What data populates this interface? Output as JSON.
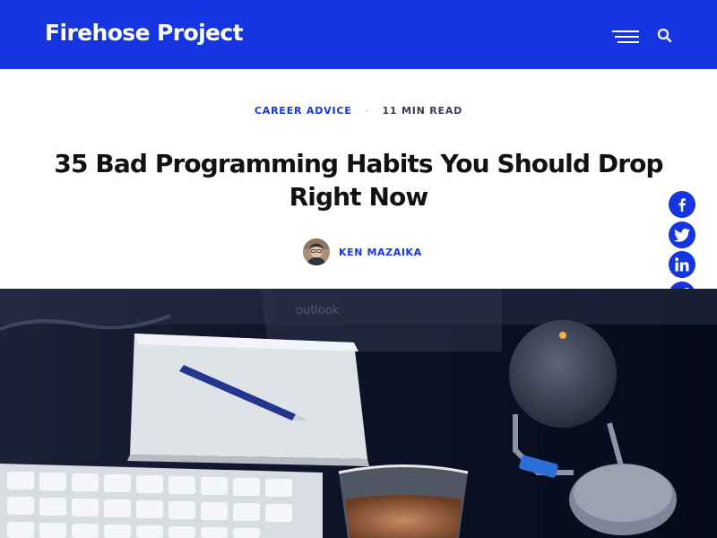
{
  "header": {
    "logo_text": "Firehose Project",
    "background_color": "#1535e0",
    "menu_icon": "hamburger-menu-icon",
    "search_icon": "search-icon"
  },
  "article": {
    "category": "CAREER ADVICE",
    "read_time": "11 MIN READ",
    "title_line1": "35 Bad Programming Habits You Should Drop",
    "title_line2": "Right Now",
    "author": {
      "name": "KEN MAZAIKA",
      "avatar_icon": "author-avatar"
    }
  },
  "share_buttons": [
    {
      "network": "facebook",
      "icon": "facebook-icon"
    },
    {
      "network": "twitter",
      "icon": "twitter-icon"
    },
    {
      "network": "linkedin",
      "icon": "linkedin-icon"
    },
    {
      "network": "copy-link",
      "icon": "link-icon"
    }
  ],
  "hero_image": {
    "subject": "desk with notebook, pen, keyboard, glass and speaker"
  },
  "colors": {
    "accent": "#1535e0",
    "title_text": "#111111",
    "meta_text": "#3a3f4b"
  }
}
